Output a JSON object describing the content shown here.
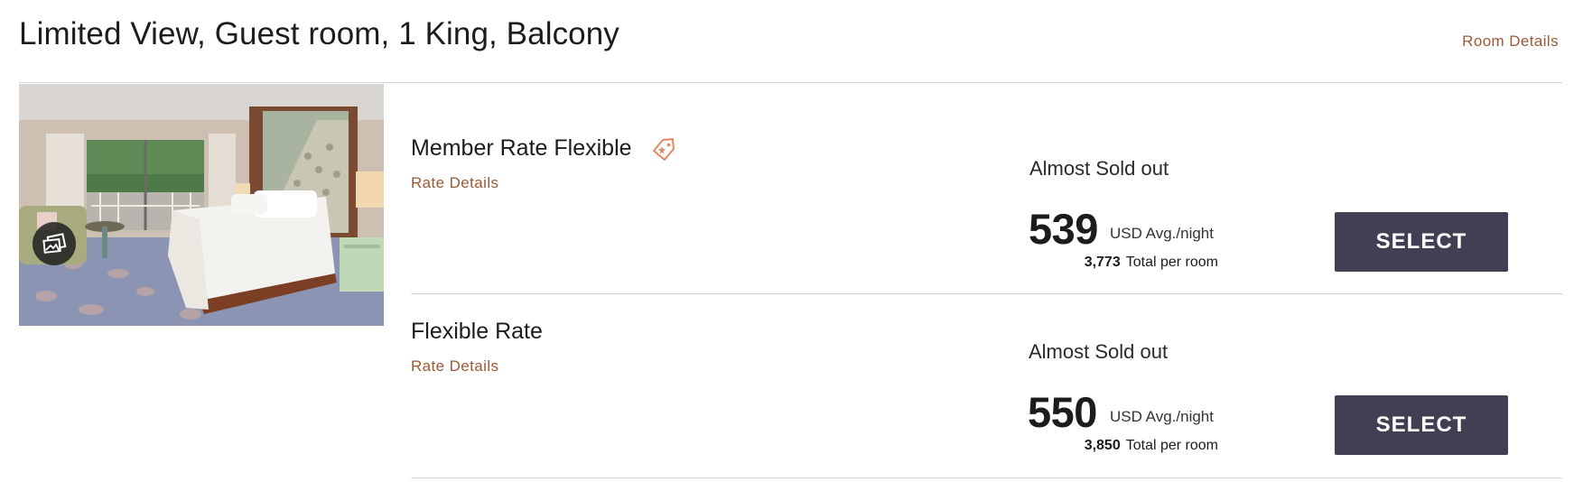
{
  "room": {
    "title": "Limited View, Guest room, 1 King, Balcony",
    "details_link": "Room Details",
    "photo_alt": "Guest room with king bed and balcony"
  },
  "rates": [
    {
      "name": "Member Rate Flexible",
      "has_member_tag": true,
      "details_link": "Rate Details",
      "availability": "Almost Sold out",
      "price": "539",
      "price_unit": "USD Avg./night",
      "total": "3,773",
      "total_label": "Total per room",
      "button": "SELECT"
    },
    {
      "name": "Flexible Rate",
      "has_member_tag": false,
      "details_link": "Rate Details",
      "availability": "Almost Sold out",
      "price": "550",
      "price_unit": "USD Avg./night",
      "total": "3,850",
      "total_label": "Total per room",
      "button": "SELECT"
    }
  ],
  "icons": {
    "member_tag": "tag-icon",
    "gallery": "photo-gallery-icon"
  },
  "colors": {
    "accent_link": "#9b5a35",
    "button_bg": "#413f53",
    "button_text": "#ffffff",
    "tag_icon": "#e4875f"
  }
}
